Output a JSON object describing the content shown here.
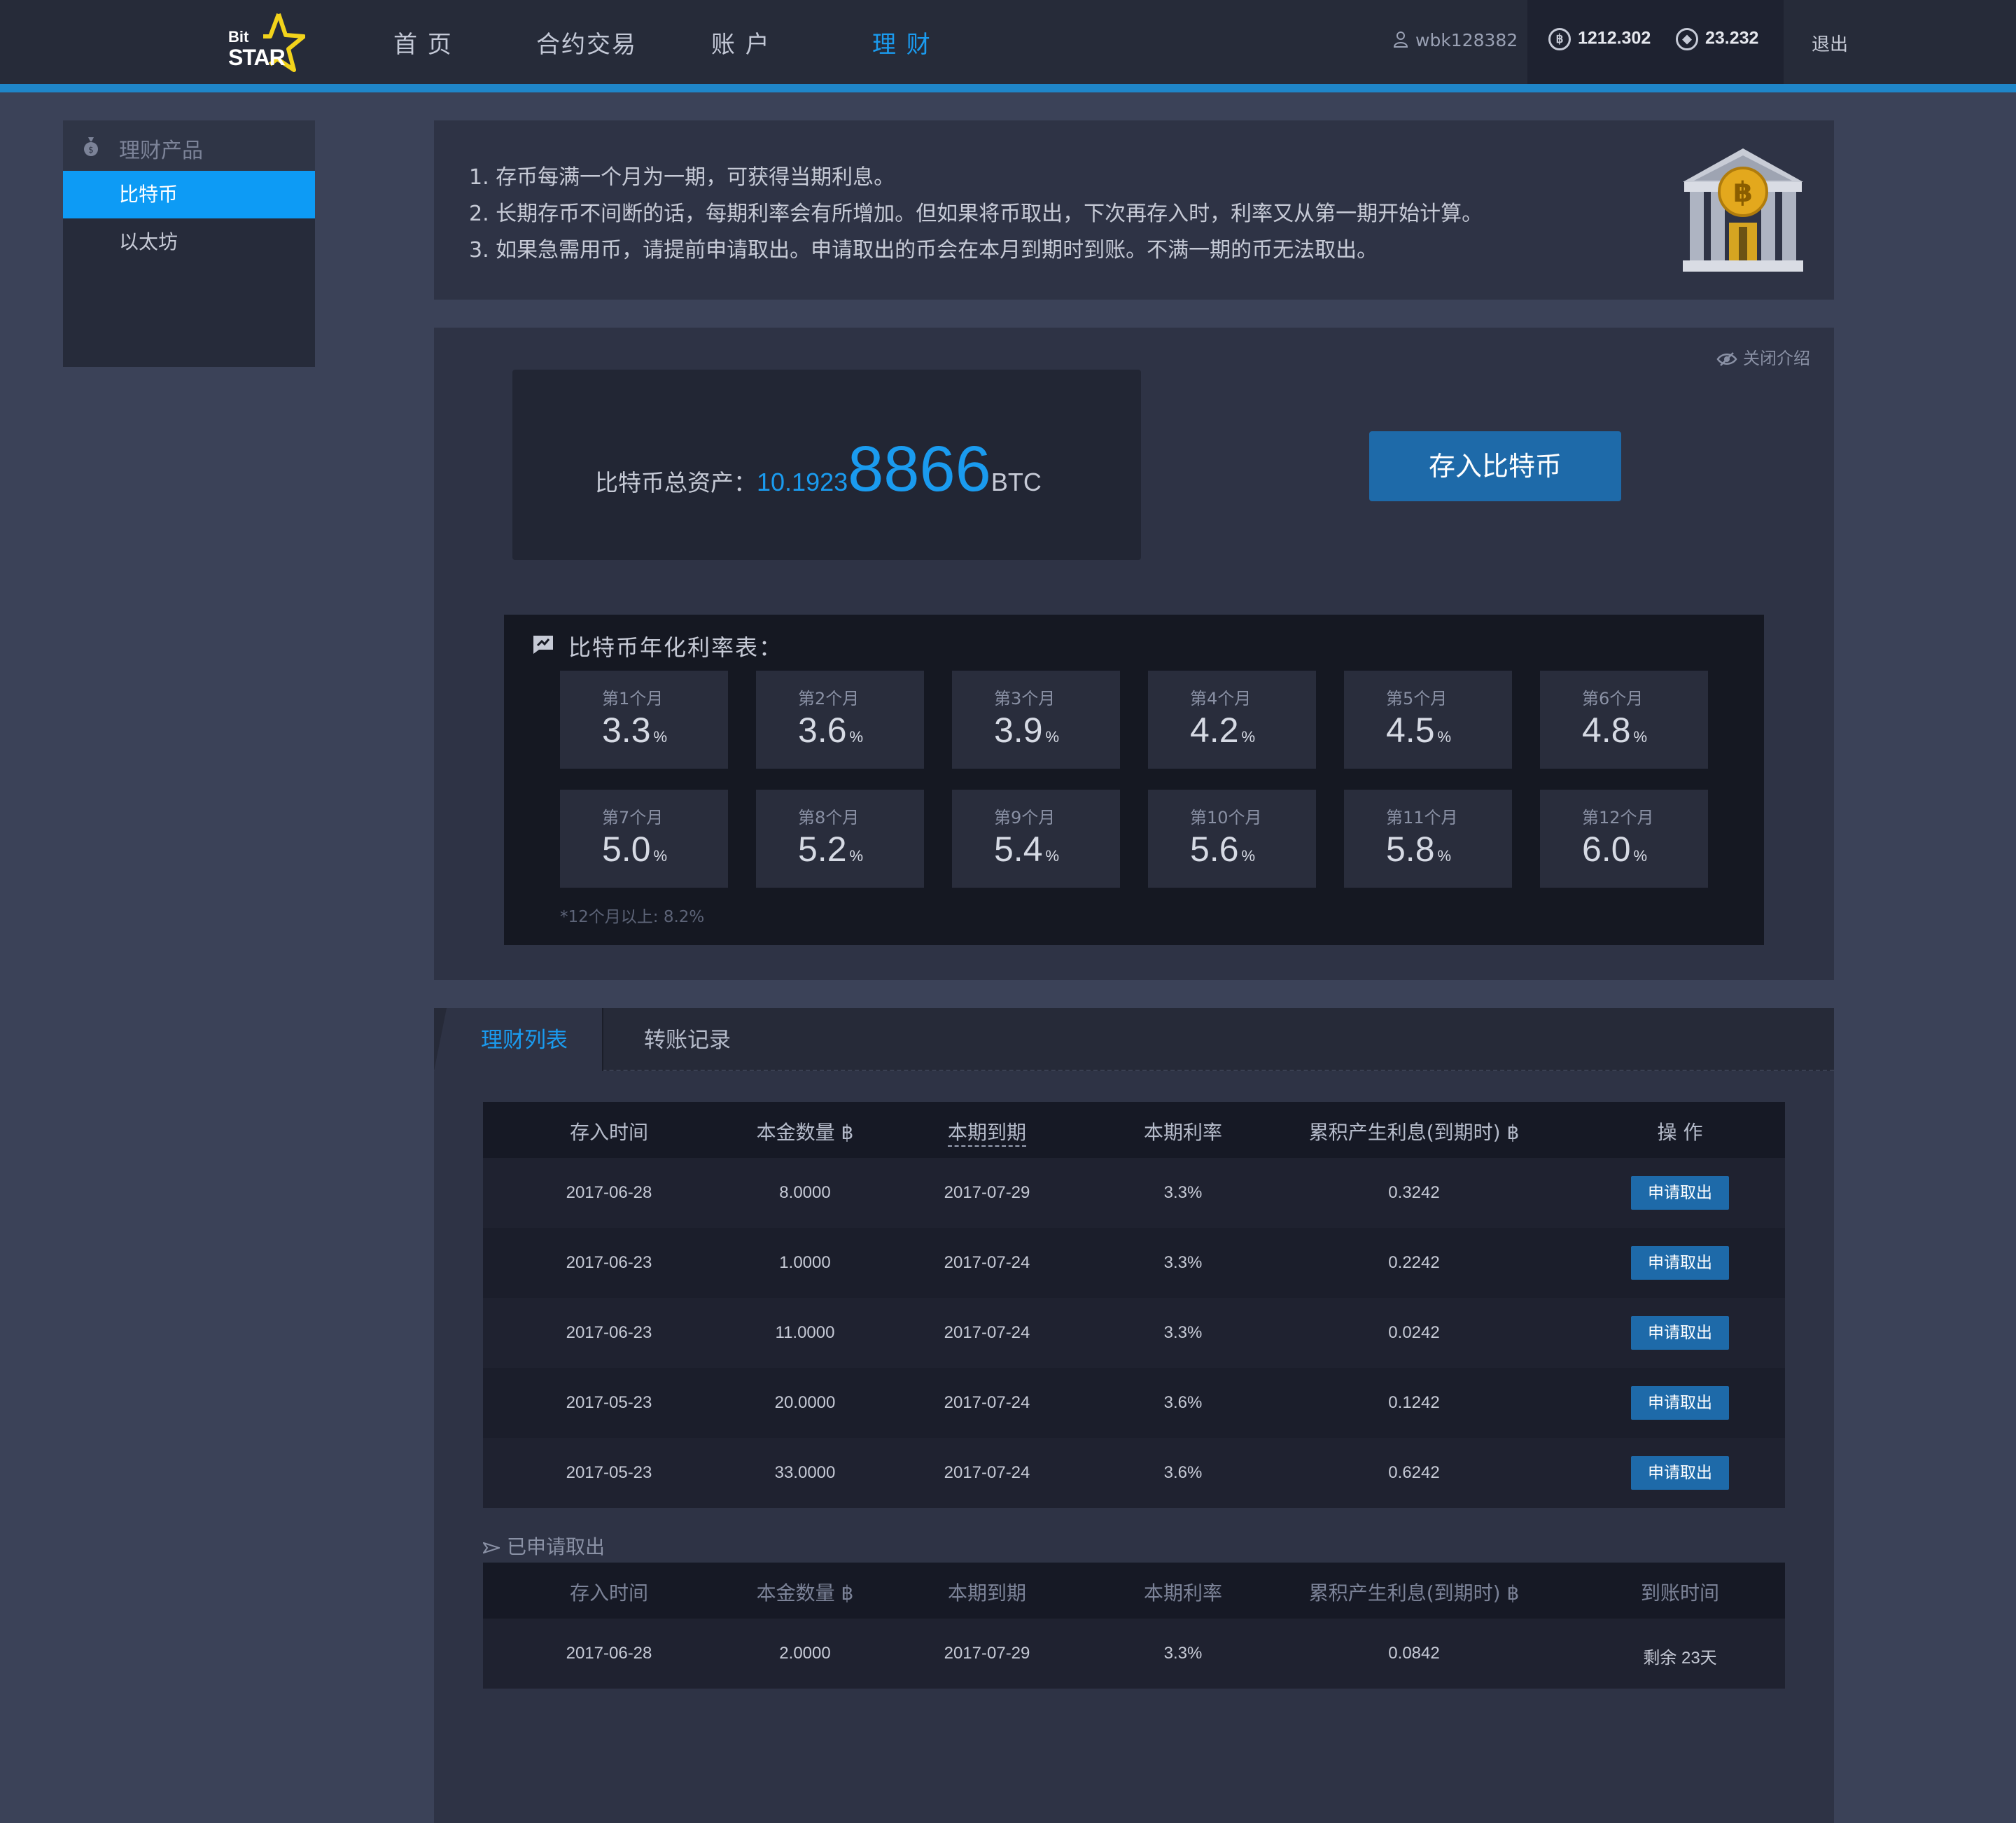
{
  "header": {
    "logo_top": "Bit",
    "logo_bottom": "STAR",
    "nav": [
      "首 页",
      "合约交易",
      "账 户",
      "理 财"
    ],
    "active_nav": "理 财",
    "username": "wbk128382",
    "btc_balance": "1212.302",
    "eth_balance": "23.232",
    "logout": "退出",
    "accent_color": "#1a9bef"
  },
  "sidebar": {
    "title": "理财产品",
    "items": [
      "比特币",
      "以太坊"
    ],
    "active_item": "比特币"
  },
  "intro": {
    "lines": [
      "1. 存币每满一个月为一期，可获得当期利息。",
      "2. 长期存币不间断的话，每期利率会有所增加。但如果将币取出，下次再存入时，利率又从第一期开始计算。",
      "3. 如果急需用币，请提前申请取出。申请取出的币会在本月到期时到账。不满一期的币无法取出。"
    ]
  },
  "main": {
    "close_intro": "关闭介绍",
    "assets_label": "比特币总资产：",
    "assets_small": "10.1923",
    "assets_big": "8866",
    "assets_unit": "BTC",
    "deposit_button": "存入比特币",
    "rate_table_title": "比特币年化利率表：",
    "rates": [
      {
        "month": "第1个月",
        "value": "3.3",
        "pct": "%"
      },
      {
        "month": "第2个月",
        "value": "3.6",
        "pct": "%"
      },
      {
        "month": "第3个月",
        "value": "3.9",
        "pct": "%"
      },
      {
        "month": "第4个月",
        "value": "4.2",
        "pct": "%"
      },
      {
        "month": "第5个月",
        "value": "4.5",
        "pct": "%"
      },
      {
        "month": "第6个月",
        "value": "4.8",
        "pct": "%"
      },
      {
        "month": "第7个月",
        "value": "5.0",
        "pct": "%"
      },
      {
        "month": "第8个月",
        "value": "5.2",
        "pct": "%"
      },
      {
        "month": "第9个月",
        "value": "5.4",
        "pct": "%"
      },
      {
        "month": "第10个月",
        "value": "5.6",
        "pct": "%"
      },
      {
        "month": "第11个月",
        "value": "5.8",
        "pct": "%"
      },
      {
        "month": "第12个月",
        "value": "6.0",
        "pct": "%"
      }
    ],
    "rate_note": "*12个月以上: 8.2%"
  },
  "tabs": [
    "理财列表",
    "转账记录"
  ],
  "active_tab": "理财列表",
  "list_table": {
    "headers": [
      "存入时间",
      "本金数量 ฿",
      "本期到期",
      "本期利率",
      "累积产生利息(到期时) ฿",
      "操  作"
    ],
    "rows": [
      [
        "2017-06-28",
        "8.0000",
        "2017-07-29",
        "3.3%",
        "0.3242",
        "申请取出"
      ],
      [
        "2017-06-23",
        "1.0000",
        "2017-07-24",
        "3.3%",
        "0.2242",
        "申请取出"
      ],
      [
        "2017-06-23",
        "11.0000",
        "2017-07-24",
        "3.3%",
        "0.0242",
        "申请取出"
      ],
      [
        "2017-05-23",
        "20.0000",
        "2017-07-24",
        "3.6%",
        "0.1242",
        "申请取出"
      ],
      [
        "2017-05-23",
        "33.0000",
        "2017-07-24",
        "3.6%",
        "0.6242",
        "申请取出"
      ]
    ]
  },
  "applied_section": {
    "title": "已申请取出",
    "headers": [
      "存入时间",
      "本金数量 ฿",
      "本期到期",
      "本期利率",
      "累积产生利息(到期时) ฿",
      "到账时间"
    ],
    "rows": [
      [
        "2017-06-28",
        "2.0000",
        "2017-07-29",
        "3.3%",
        "0.0842",
        "剩余 23天"
      ]
    ]
  }
}
